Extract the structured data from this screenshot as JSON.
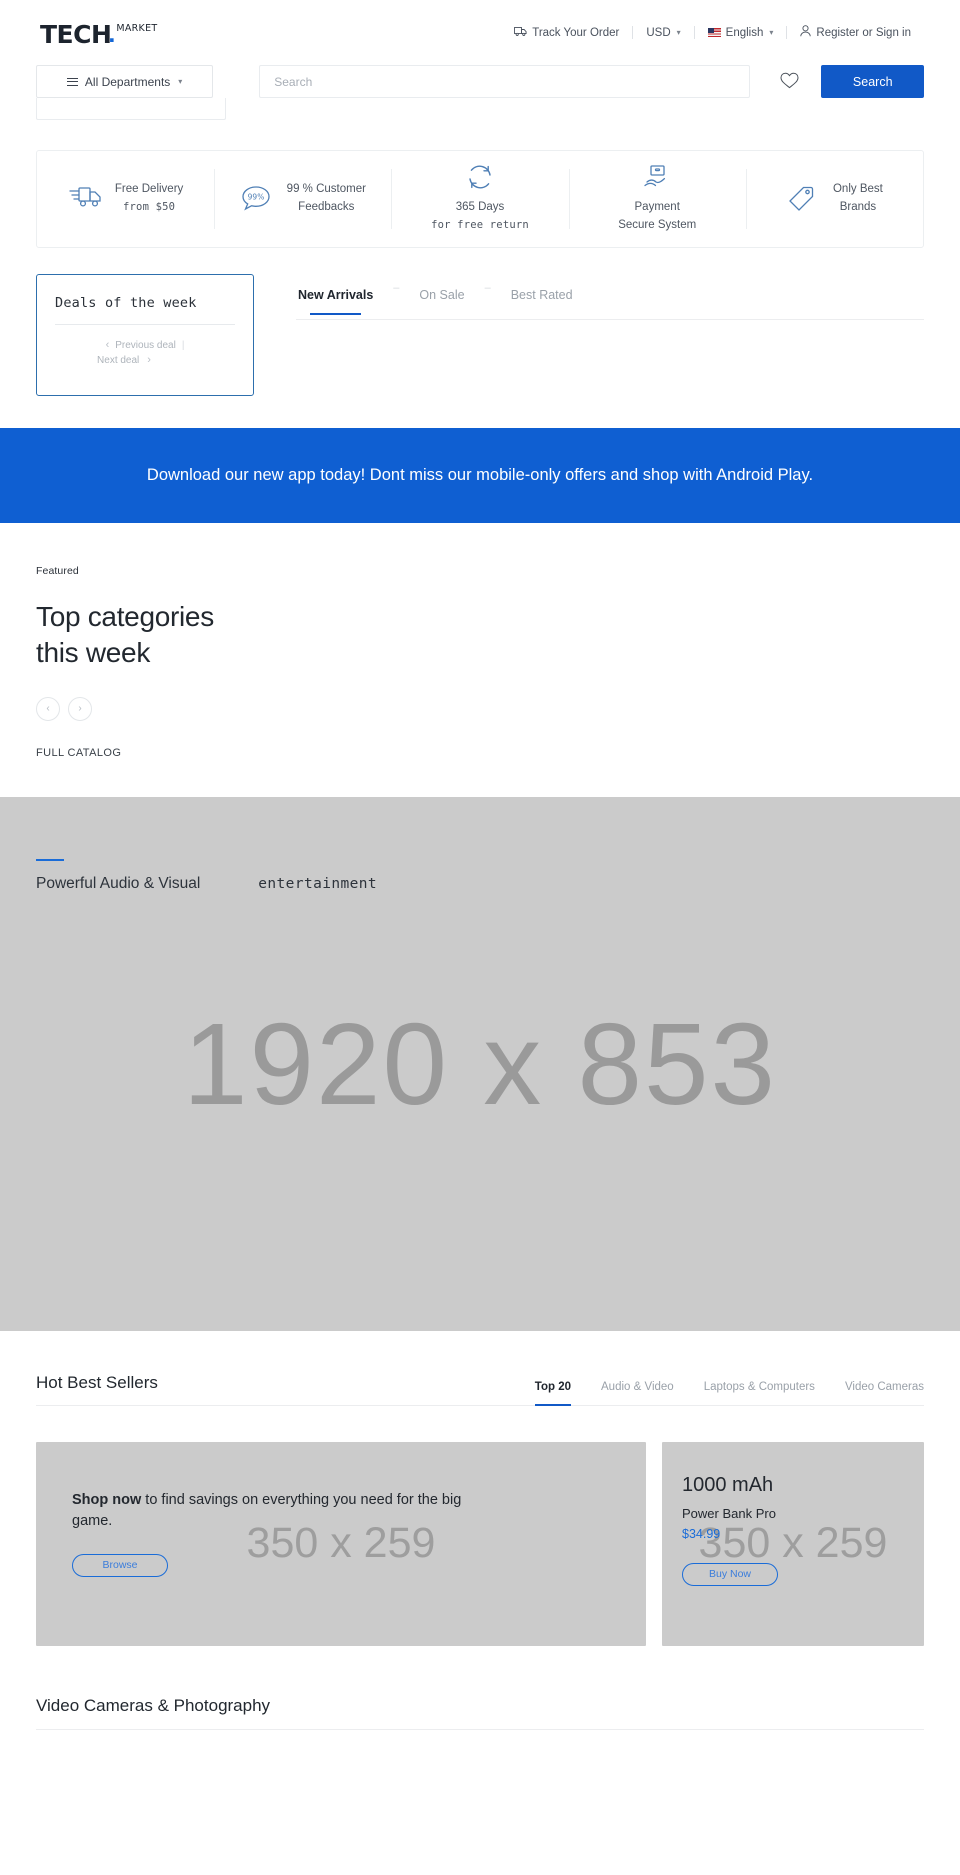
{
  "header": {
    "logo": {
      "main": "TECH",
      "dot": ".",
      "sub": "MARKET"
    },
    "top_links": [
      {
        "label": "Track Your Order",
        "icon": "truck-icon"
      },
      {
        "label": "USD",
        "icon": "chevron-down-icon"
      },
      {
        "label": "English",
        "icon": "flag-us-icon"
      },
      {
        "label": "Register or Sign in",
        "icon": "user-icon"
      }
    ],
    "departments_label": "All Departments",
    "search_placeholder": "Search",
    "search_value": "",
    "search_button": "Search",
    "wishlist_icon": "heart-icon"
  },
  "features": [
    {
      "icon": "delivery-truck-icon",
      "line1": "Free Delivery",
      "line2": "from  $50"
    },
    {
      "icon": "feedback-99-icon",
      "line1": "99 % Customer",
      "line2": "Feedbacks"
    },
    {
      "icon": "refresh-return-icon",
      "line1": "365 Days",
      "line2": "for free return"
    },
    {
      "icon": "secure-payment-icon",
      "line1": "Payment",
      "line2": "Secure System"
    },
    {
      "icon": "price-tag-icon",
      "line1": "Only Best",
      "line2": "Brands"
    }
  ],
  "deals": {
    "title": "Deals  of the week",
    "previous_label": "Previous deal",
    "next_label": "Next deal"
  },
  "product_tabs": [
    {
      "label": "New Arrivals",
      "active": true
    },
    {
      "label": "On Sale",
      "active": false
    },
    {
      "label": "Best Rated",
      "active": false
    }
  ],
  "app_banner": {
    "text": "Download our new app today! Dont miss our mobile-only offers and shop with Android Play."
  },
  "featured": {
    "eyebrow": "Featured",
    "title_line1": "Top categories",
    "title_line2": "this week",
    "prev_icon": "chevron-left-icon",
    "next_icon": "chevron-right-icon",
    "full_catalog": "FULL CATALOG"
  },
  "hero": {
    "placeholder": "1920 x 853",
    "headline_a": "Powerful Audio & Visual",
    "headline_b": "entertainment"
  },
  "best_sellers": {
    "title": "Hot Best Sellers",
    "tabs": [
      {
        "label": "Top 20",
        "active": true
      },
      {
        "label": "Audio & Video",
        "active": false
      },
      {
        "label": "Laptops & Computers",
        "active": false
      },
      {
        "label": "Video Cameras",
        "active": false
      }
    ]
  },
  "promos": [
    {
      "placeholder": "350 x 259",
      "headline_bold": "Shop now",
      "headline_rest": " to find savings on everything you need for the big game.",
      "button": "Browse"
    },
    {
      "placeholder": "350 x 259",
      "kicker": "1000 mAh",
      "sub": "Power Bank Pro",
      "price": "$34.99",
      "button": "Buy Now"
    }
  ],
  "video_cameras": {
    "title": "Video Cameras & Photography"
  }
}
